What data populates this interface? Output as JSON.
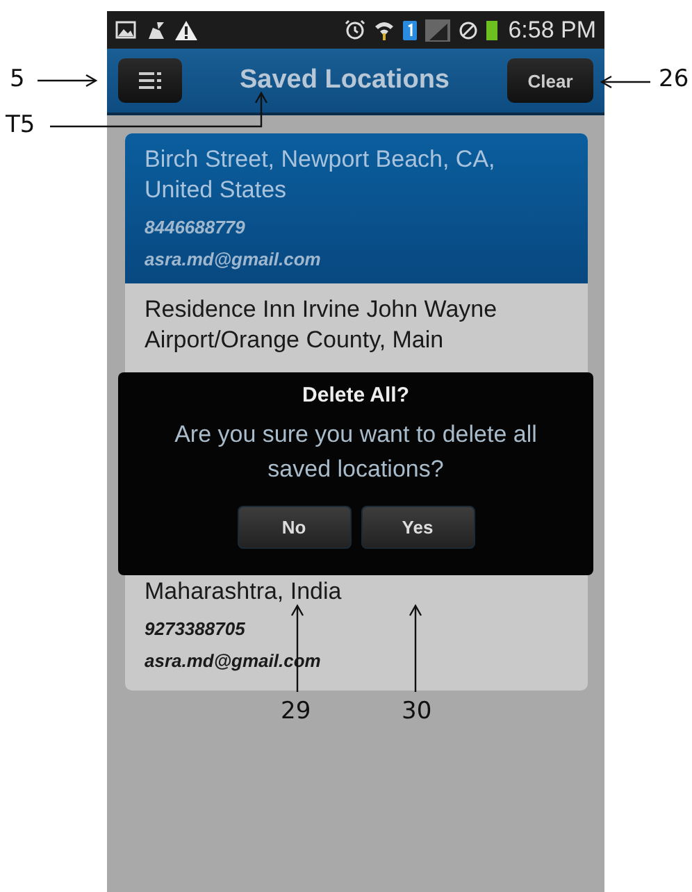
{
  "status_bar": {
    "time": "6:58 PM"
  },
  "header": {
    "title": "Saved Locations",
    "clear_button": "Clear"
  },
  "locations": [
    {
      "address": "Birch Street, Newport Beach, CA, United States",
      "phone": "8446688779",
      "email": "asra.md@gmail.com",
      "selected": true
    },
    {
      "address": "Residence Inn Irvine John Wayne Airport/Orange County, Main",
      "selected": false
    },
    {
      "address": "Maharashtra, India",
      "phone": "9273388705",
      "email": "asra.md@gmail.com",
      "selected": false
    }
  ],
  "dialog": {
    "title": "Delete All?",
    "message": "Are you sure you want to delete all saved locations?",
    "buttons": [
      "No",
      "Yes"
    ]
  },
  "callouts": [
    {
      "label": "5"
    },
    {
      "label": "T5"
    },
    {
      "label": "26"
    },
    {
      "label": "29"
    },
    {
      "label": "30"
    }
  ]
}
